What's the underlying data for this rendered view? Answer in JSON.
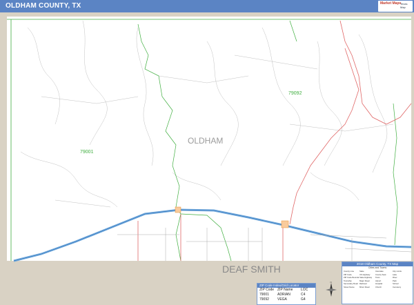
{
  "header": {
    "title": "OLDHAM COUNTY, TX",
    "logo_text": "Market Maps",
    "logo_sub": "Texas Map"
  },
  "colors": {
    "header_bg": "#5b84c4",
    "map_bg": "#ffffff",
    "outside_bg": "#d9d2c4",
    "zip_boundary": "#3fae3f",
    "highway": "#6fa8dc",
    "state_road": "#e06666",
    "us_route": "#e69138",
    "road": "#999999"
  },
  "map": {
    "county_label": "OLDHAM",
    "neighbor_label": "DEAF SMITH",
    "zip_labels": [
      "79001",
      "79092"
    ]
  },
  "zip_table": {
    "title": "ZIP Code Index/Grid Locator",
    "headers": [
      "ZIP Code",
      "ZIP Name",
      "LOC"
    ],
    "rows": [
      [
        "79001",
        "ADRIAN",
        "C4"
      ],
      [
        "79092",
        "VEGA",
        "G4"
      ]
    ]
  },
  "legend": {
    "title": "2018 Oldham County, TX Map",
    "subtitle": "Cities and Towns",
    "items": [
      "County Line",
      "State",
      "Interstate",
      "City Limits",
      "ZIP Code",
      "US Highway",
      "County Seat",
      "Lake",
      "ZIP Code Boundary",
      "State Highway",
      "Town",
      "River",
      "Township",
      "Major Road",
      "Airport",
      "Park",
      "Secondary Road",
      "Railroad",
      "Hospital",
      "School",
      "Street Name",
      "Minor Road",
      "Church",
      "Cemetery"
    ]
  }
}
